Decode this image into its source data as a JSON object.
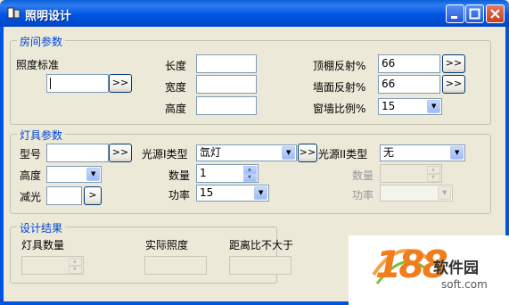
{
  "window": {
    "title": "照明设计"
  },
  "room": {
    "legend": "房间参数",
    "illum_std_label": "照度标准",
    "illum_std_value": "",
    "illum_btn": ">>",
    "length_label": "长度",
    "length_value": "",
    "width_label": "宽度",
    "width_value": "",
    "height_label": "高度",
    "height_value": "",
    "ceiling_label": "顶棚反射%",
    "ceiling_value": "66",
    "ceiling_btn": ">>",
    "wall_label": "墙面反射%",
    "wall_value": "66",
    "wall_btn": ">>",
    "window_label": "窗墙比例%",
    "window_value": "15"
  },
  "lamp": {
    "legend": "灯具参数",
    "model_label": "型号",
    "model_value": "",
    "model_btn": ">>",
    "height_label": "高度",
    "height_value": "",
    "dim_label": "减光",
    "dim_value": "",
    "dim_btn": ">",
    "src1_label": "光源I类型",
    "src1_value": "氙灯",
    "src1_btn": ">>",
    "qty1_label": "数量",
    "qty1_value": "1",
    "power1_label": "功率",
    "power1_value": "15",
    "src2_label": "光源II类型",
    "src2_value": "无",
    "qty2_label": "数量",
    "qty2_value": "",
    "power2_label": "功率",
    "power2_value": ""
  },
  "result": {
    "legend": "设计结果",
    "count_label": "灯具数量",
    "count_value": "",
    "actual_label": "实际照度",
    "actual_value": "",
    "ratio_label": "距离比不大于",
    "ratio_value": ""
  },
  "watermark": {
    "number": "188",
    "name": "软件园",
    "url": "soft.com"
  },
  "colors": {
    "titlebar": "#0054e3",
    "face": "#ece9d8",
    "legend": "#0046d5",
    "accent": "#f07c1c"
  }
}
